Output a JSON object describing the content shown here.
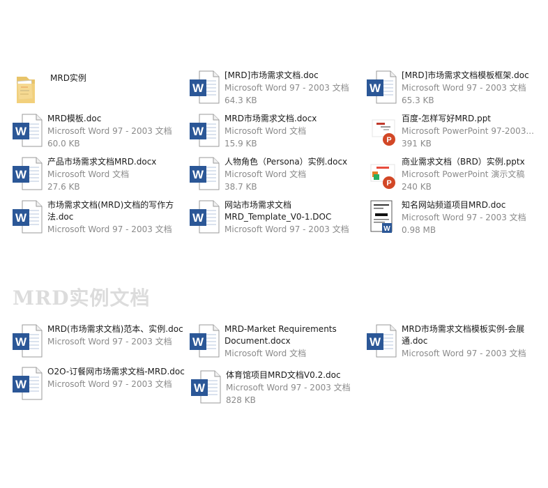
{
  "colors": {
    "word_blue": "#2b5797",
    "ppt_orange": "#d24726",
    "text": "#1a1a1a",
    "muted": "#8a8a8a",
    "heading": "#dcdcdc"
  },
  "section1": {
    "folder": {
      "name": "MRD实例",
      "icon": "folder-icon"
    },
    "files": [
      {
        "name": "[MRD]市场需求文档.doc",
        "type": "Microsoft Word 97 - 2003 文档",
        "size": "64.3 KB",
        "icon": "word-doc-icon"
      },
      {
        "name": "[MRD]市场需求文档模板框架.doc",
        "type": "Microsoft Word 97 - 2003 文档",
        "size": "65.3 KB",
        "icon": "word-doc-icon"
      },
      {
        "name": "MRD模板.doc",
        "type": "Microsoft Word 97 - 2003 文档",
        "size": "60.0 KB",
        "icon": "word-doc-icon"
      },
      {
        "name": "MRD市场需求文档.docx",
        "type": "Microsoft Word 文档",
        "size": "15.9 KB",
        "icon": "word-doc-icon"
      },
      {
        "name": "百度-怎样写好MRD.ppt",
        "type": "Microsoft PowerPoint 97-2003...",
        "size": "391 KB",
        "icon": "powerpoint-icon"
      },
      {
        "name": "产品市场需求文档MRD.docx",
        "type": "Microsoft Word 文档",
        "size": "27.6 KB",
        "icon": "word-doc-icon"
      },
      {
        "name": "人物角色（Persona）实例.docx",
        "type": "Microsoft Word 文档",
        "size": "38.7 KB",
        "icon": "word-doc-icon"
      },
      {
        "name": "商业需求文档（BRD）实例.pptx",
        "type": "Microsoft PowerPoint 演示文稿",
        "size": "240 KB",
        "icon": "powerpoint-icon"
      },
      {
        "name": "市场需求文档(MRD)文档的写作方法.doc",
        "type": "Microsoft Word 97 - 2003 文档",
        "icon": "word-doc-icon"
      },
      {
        "name": "网站市场需求文档MRD_Template_V0-1.DOC",
        "type": "Microsoft Word 97 - 2003 文档",
        "icon": "word-doc-icon"
      },
      {
        "name": "知名网站频道项目MRD.doc",
        "type": "Microsoft Word 97 - 2003 文档",
        "size": "0.98 MB",
        "icon": "word-thumbnail-icon"
      }
    ]
  },
  "section2": {
    "heading": "MRD实例文档",
    "files": [
      {
        "name": "MRD(市场需求文档)范本、实例.doc",
        "type": "Microsoft Word 97 - 2003 文档",
        "icon": "word-doc-icon"
      },
      {
        "name": "MRD-Market Requirements Document.docx",
        "type": "Microsoft Word 文档",
        "icon": "word-doc-icon"
      },
      {
        "name": "MRD市场需求文档模板实例-会展通.doc",
        "type": "Microsoft Word 97 - 2003 文档",
        "icon": "word-doc-icon"
      },
      {
        "name": "O2O-订餐网市场需求文档-MRD.doc",
        "type": "Microsoft Word 97 - 2003 文档",
        "icon": "word-doc-icon"
      },
      {
        "name": "体育馆项目MRD文档V0.2.doc",
        "type": "Microsoft Word 97 - 2003 文档",
        "size": "828 KB",
        "icon": "word-doc-icon"
      }
    ]
  }
}
